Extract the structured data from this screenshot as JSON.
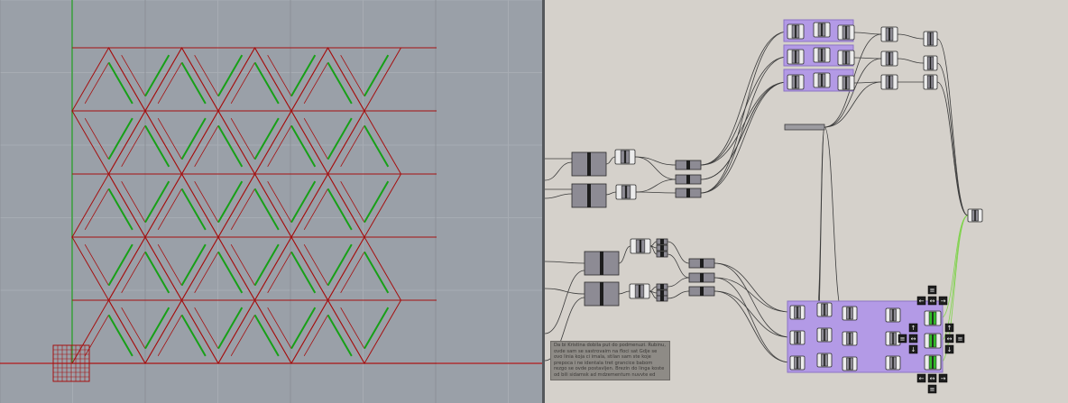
{
  "app": {
    "left_pane": "rhino-viewport",
    "right_pane": "grasshopper-canvas"
  },
  "viewport": {
    "axis_x_color": "#b01717",
    "axis_y_color": "#1c9c1c",
    "mesh_edge_color": "#a50f0f",
    "diagonal_color": "#17a017",
    "background": "#9aa0a8"
  },
  "canvas": {
    "background": "#d5d1cb",
    "group_color": "#b39ae6",
    "component_color": "#8d8b94",
    "active_component_color": "#33bb2a",
    "note_text": "Da bi Kristina dobila put do podmenuzi. Rubinu, ovde sam se sastrovaim na floci sat Gdje se ovo linia koja ci imala, stilan sam ste koje prepoca i ne identala tret grancice babom rezgo se ovde postavljen. Brezin do linga koste od bili sidamsk ad mdzementum nuvvte ed"
  }
}
